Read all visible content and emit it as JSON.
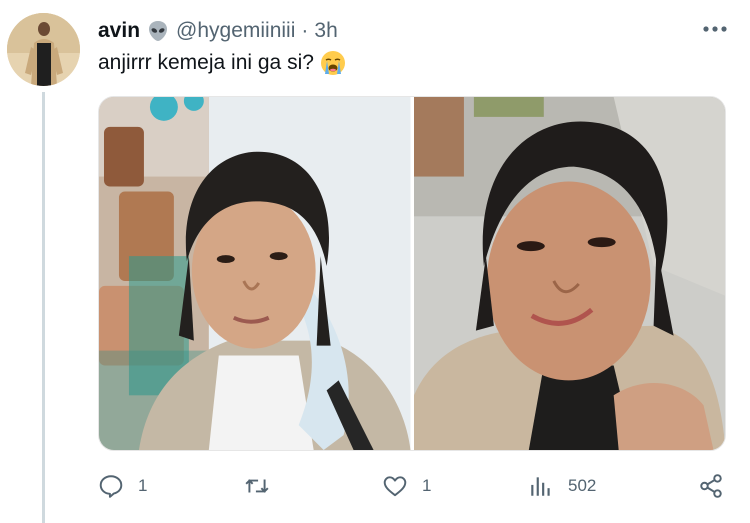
{
  "tweet": {
    "name": "avin",
    "handle": "@hygemiiniii",
    "separator": "·",
    "time": "3h",
    "text": "anjirrr kemeja ini ga si?",
    "emoji_icon": "loudly-crying-face-icon",
    "verified_icon": "alien-icon"
  },
  "actions": {
    "replies": "1",
    "retweets": "",
    "likes": "1",
    "views": "502"
  },
  "colors": {
    "text": "#0f1419",
    "secondary": "#536471",
    "thread_line": "#cfd9de"
  }
}
